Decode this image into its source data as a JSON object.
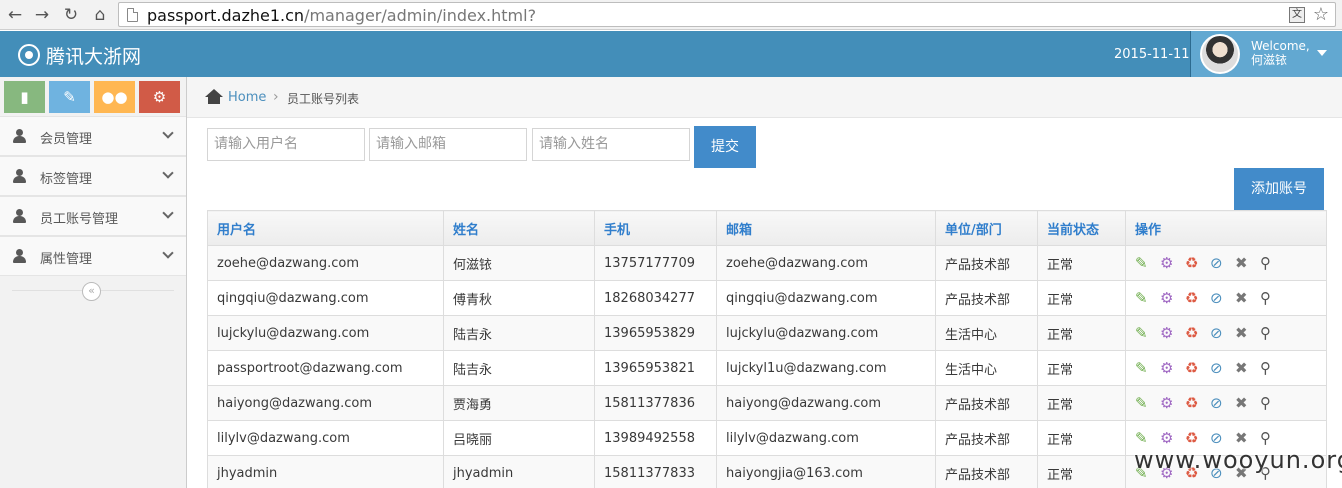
{
  "browser": {
    "url_host": "passport.dazhe1.cn",
    "url_path": "/manager/admin/index.html?"
  },
  "navbar": {
    "brand": "腾讯大浙网",
    "date": "2015-11-11",
    "welcome": "Welcome,",
    "user_name": "何滋铱",
    "brand_color": "#438eb9"
  },
  "sidebar": {
    "items": [
      {
        "label": "会员管理"
      },
      {
        "label": "标签管理"
      },
      {
        "label": "员工账号管理"
      },
      {
        "label": "属性管理"
      }
    ]
  },
  "breadcrumb": {
    "home": "Home",
    "current": "员工账号列表"
  },
  "filters": {
    "username_placeholder": "请输入用户名",
    "email_placeholder": "请输入邮箱",
    "name_placeholder": "请输入姓名",
    "submit_label": "提交",
    "add_label": "添加账号"
  },
  "table": {
    "headers": [
      "用户名",
      "姓名",
      "手机",
      "邮箱",
      "单位/部门",
      "当前状态",
      "操作"
    ],
    "rows": [
      [
        "zoehe@dazwang.com",
        "何滋铱",
        "13757177709",
        "zoehe@dazwang.com",
        "产品技术部",
        "正常"
      ],
      [
        "qingqiu@dazwang.com",
        "傅青秋",
        "18268034277",
        "qingqiu@dazwang.com",
        "产品技术部",
        "正常"
      ],
      [
        "lujckylu@dazwang.com",
        "陆吉永",
        "13965953829",
        "lujckylu@dazwang.com",
        "生活中心",
        "正常"
      ],
      [
        "passportroot@dazwang.com",
        "陆吉永",
        "13965953821",
        "lujckyl1u@dazwang.com",
        "生活中心",
        "正常"
      ],
      [
        "haiyong@dazwang.com",
        "贾海勇",
        "15811377836",
        "haiyong@dazwang.com",
        "产品技术部",
        "正常"
      ],
      [
        "lilylv@dazwang.com",
        "吕晓丽",
        "13989492558",
        "lilylv@dazwang.com",
        "产品技术部",
        "正常"
      ],
      [
        "jhyadmin",
        "jhyadmin",
        "15811377833",
        "haiyongjia@163.com",
        "产品技术部",
        "正常"
      ]
    ],
    "actions": [
      "edit-icon",
      "gear-icon",
      "recycle-icon",
      "ban-icon",
      "delete-icon",
      "search-icon"
    ]
  },
  "watermark": "www.wooyun.org"
}
